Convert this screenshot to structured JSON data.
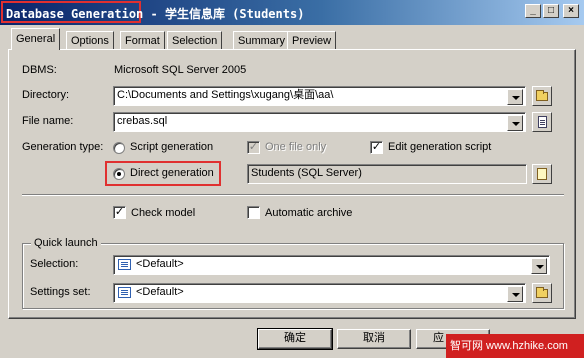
{
  "window": {
    "title_app": "Database Generation",
    "title_rest": " - 学生信息库 (Students)",
    "minimize_glyph": "_",
    "maximize_glyph": "□",
    "close_glyph": "×"
  },
  "tabs": [
    "General",
    "Options",
    "Format",
    "Selection",
    "Summary",
    "Preview"
  ],
  "general": {
    "dbms_label": "DBMS:",
    "dbms_value": "Microsoft SQL Server 2005",
    "directory_label": "Directory:",
    "directory_value": "C:\\Documents and Settings\\xugang\\桌面\\aa\\",
    "filename_label": "File name:",
    "filename_value": "crebas.sql",
    "gentype_label": "Generation type:",
    "script_generation": "Script generation",
    "direct_generation": "Direct generation",
    "one_file_only": "One file only",
    "edit_generation_script": "Edit generation script",
    "datasource_value": "Students (SQL Server)",
    "check_model": "Check model",
    "automatic_archive": "Automatic archive",
    "check_mark": "✓"
  },
  "quick_launch": {
    "title": "Quick launch",
    "selection_label": "Selection:",
    "selection_value": "<Default>",
    "settings_label": "Settings set:",
    "settings_value": "<Default>"
  },
  "buttons": {
    "ok": "确定",
    "cancel": "取消",
    "apply": "应"
  },
  "watermark": "智可网 www.hzhike.com",
  "state": {
    "generation_type": "direct",
    "one_file_only": true,
    "edit_generation_script": true,
    "check_model": true,
    "automatic_archive": false
  },
  "colors": {
    "titlebar_start": "#0a246a",
    "titlebar_end": "#a6caf0",
    "highlight_red": "#e03030",
    "dialog_bg": "#d4d0c8"
  }
}
